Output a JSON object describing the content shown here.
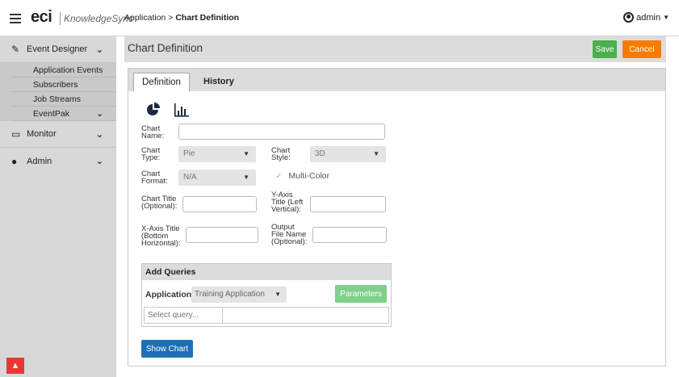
{
  "header": {
    "logo_main": "eci",
    "logo_product": "KnowledgeSync",
    "breadcrumb_parent": "Application",
    "breadcrumb_sep": " > ",
    "breadcrumb_current": "Chart Definition",
    "user": "admin"
  },
  "sidebar": {
    "event_designer": "Event Designer",
    "sub_items": [
      "Application Events",
      "Subscribers",
      "Job Streams",
      "EventPak"
    ],
    "monitor": "Monitor",
    "admin": "Admin"
  },
  "page": {
    "title": "Chart Definition",
    "save_label": "Save",
    "cancel_label": "Cancel"
  },
  "tabs": [
    "Definition",
    "History"
  ],
  "form": {
    "chart_name_label": [
      "Chart",
      "Name:"
    ],
    "chart_type_label": [
      "Chart",
      "Type:"
    ],
    "chart_type_value": "Pie",
    "chart_style_label": [
      "Chart",
      "Style:"
    ],
    "chart_style_value": "3D",
    "chart_format_label": [
      "Chart",
      "Format:"
    ],
    "chart_format_value": "N/A",
    "multi_color_label": "Multi-Color",
    "chart_title_label": [
      "Chart Title",
      "(Optional):"
    ],
    "y_axis_label": [
      "Y-Axis",
      "Title (Left",
      "Vertical):"
    ],
    "x_axis_label": [
      "X-Axis Title",
      "(Bottom",
      "Horizontal):"
    ],
    "output_label": [
      "Output",
      "File Name",
      "(Optional):"
    ]
  },
  "queries": {
    "header": "Add Queries",
    "application_label": "Application:",
    "application_value": "Training Application",
    "parameters_label": "Parameters",
    "query_placeholder": "Select query..."
  },
  "show_chart_label": "Show Chart",
  "colors": {
    "save": "#4caf50",
    "cancel": "#f57c00",
    "show_chart": "#1e6fb5",
    "parameters": "#7ed08a",
    "scroll_up": "#e53935"
  }
}
